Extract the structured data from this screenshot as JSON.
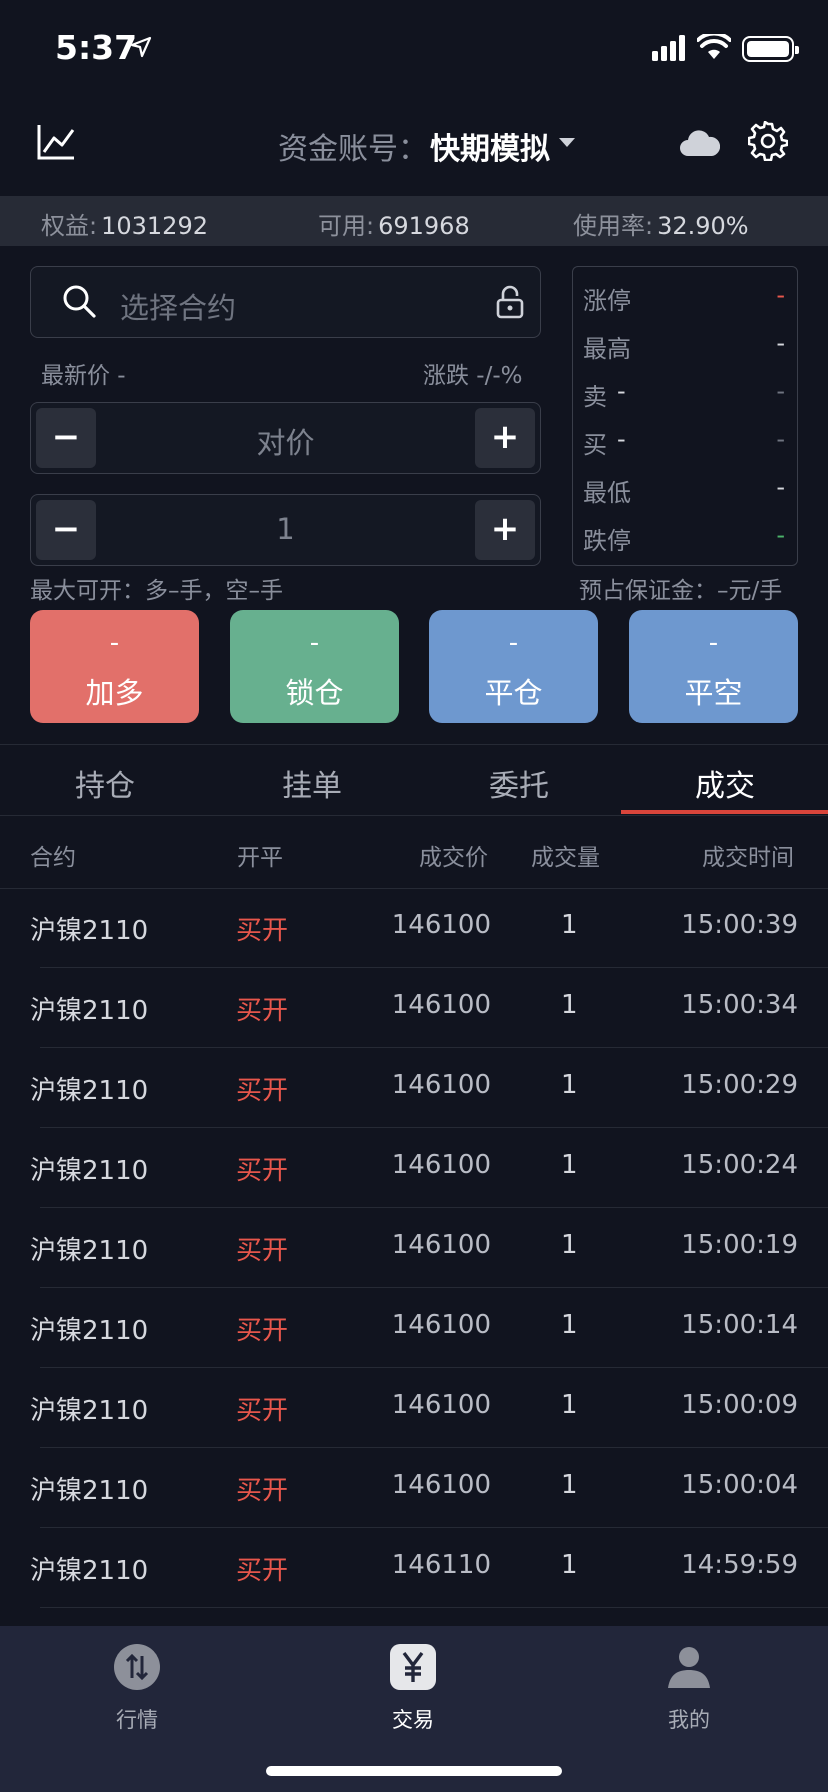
{
  "status_bar": {
    "time": "5:37"
  },
  "header": {
    "account_label": "资金账号：",
    "account_name": "快期模拟"
  },
  "summary": [
    {
      "label": "权益:",
      "value": "1031292"
    },
    {
      "label": "可用:",
      "value": "691968"
    },
    {
      "label": "使用率:",
      "value": "32.90%"
    }
  ],
  "order_form": {
    "search_placeholder": "选择合约",
    "latest_price_label": "最新价 -",
    "change_label": "涨跌 -/-%",
    "price_mode": "对价",
    "quantity": "1",
    "minus": "−",
    "plus": "+",
    "max_open": "最大可开：多–手，空–手",
    "margin": "预占保证金：–元/手"
  },
  "quote_panel": [
    {
      "label": "涨停",
      "value": "-",
      "color": "#e8574c"
    },
    {
      "label": "最高",
      "value": "-"
    },
    {
      "label": "卖",
      "mid": "-",
      "value": "-"
    },
    {
      "label": "买",
      "mid": "-",
      "value": "-"
    },
    {
      "label": "最低",
      "value": "-"
    },
    {
      "label": "跌停",
      "value": "-",
      "color": "#4bb36a"
    }
  ],
  "actions": [
    {
      "price": "-",
      "label": "加多",
      "color": "#e2706a"
    },
    {
      "price": "-",
      "label": "锁仓",
      "color": "#67b08f"
    },
    {
      "price": "-",
      "label": "平仓",
      "color": "#6e98cf"
    },
    {
      "price": "-",
      "label": "平空",
      "color": "#6e98cf"
    }
  ],
  "tabs": [
    "持仓",
    "挂单",
    "委托",
    "成交"
  ],
  "active_tab": "成交",
  "table": {
    "headers": [
      "合约",
      "开平",
      "成交价",
      "成交量",
      "成交时间"
    ],
    "rows": [
      {
        "contract": "沪镍2110",
        "dir": "买开",
        "price": "146100",
        "qty": "1",
        "time": "15:00:39"
      },
      {
        "contract": "沪镍2110",
        "dir": "买开",
        "price": "146100",
        "qty": "1",
        "time": "15:00:34"
      },
      {
        "contract": "沪镍2110",
        "dir": "买开",
        "price": "146100",
        "qty": "1",
        "time": "15:00:29"
      },
      {
        "contract": "沪镍2110",
        "dir": "买开",
        "price": "146100",
        "qty": "1",
        "time": "15:00:24"
      },
      {
        "contract": "沪镍2110",
        "dir": "买开",
        "price": "146100",
        "qty": "1",
        "time": "15:00:19"
      },
      {
        "contract": "沪镍2110",
        "dir": "买开",
        "price": "146100",
        "qty": "1",
        "time": "15:00:14"
      },
      {
        "contract": "沪镍2110",
        "dir": "买开",
        "price": "146100",
        "qty": "1",
        "time": "15:00:09"
      },
      {
        "contract": "沪镍2110",
        "dir": "买开",
        "price": "146100",
        "qty": "1",
        "time": "15:00:04"
      },
      {
        "contract": "沪镍2110",
        "dir": "买开",
        "price": "146110",
        "qty": "1",
        "time": "14:59:59"
      }
    ]
  },
  "bottom_nav": [
    {
      "label": "行情",
      "icon": "market-icon"
    },
    {
      "label": "交易",
      "icon": "yen-icon"
    },
    {
      "label": "我的",
      "icon": "user-icon"
    }
  ],
  "active_nav": "交易"
}
